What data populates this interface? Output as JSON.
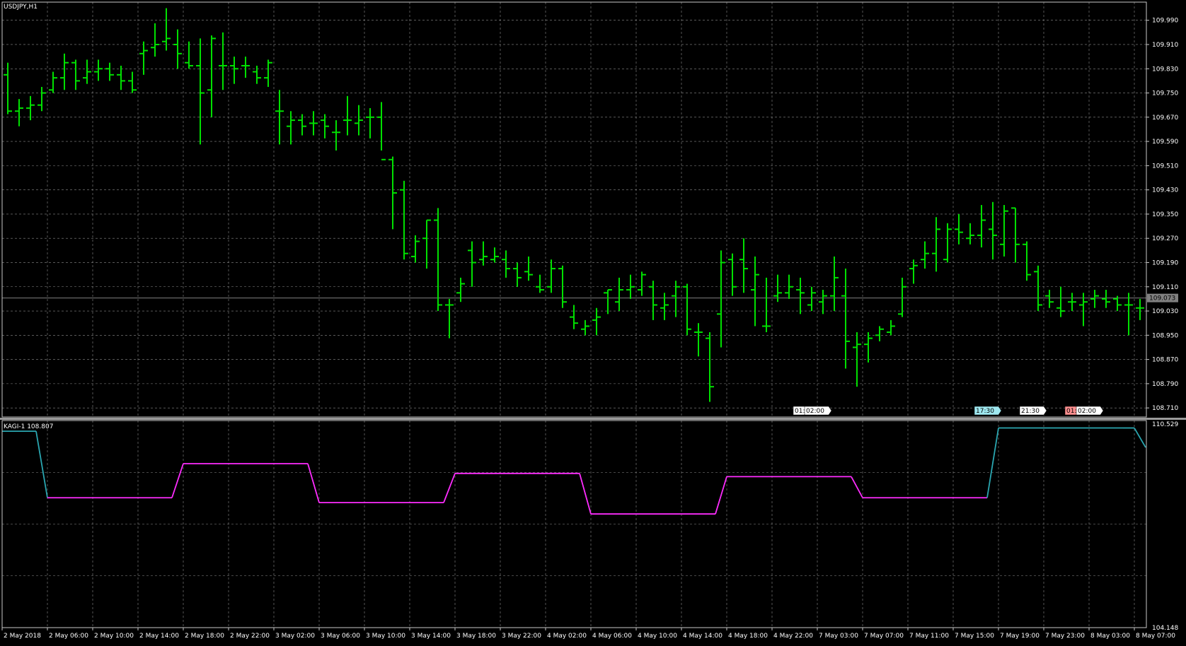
{
  "window": {
    "symbol_label": "USDJPY,H1"
  },
  "colors": {
    "background": "#000000",
    "grid": "#8c8c8c",
    "frame": "#c8c8c8",
    "bars": "#00e000",
    "kagi_yang": "#2aa6b0",
    "kagi_yin": "#ff2cff",
    "bid_line": "#808080"
  },
  "indicator": {
    "label": "KAGI-1 108.807"
  },
  "price_scale": {
    "ticks": [
      "109.990",
      "109.910",
      "109.830",
      "109.750",
      "109.670",
      "109.590",
      "109.510",
      "109.430",
      "109.350",
      "109.270",
      "109.190",
      "109.110",
      "109.030",
      "108.950",
      "108.870",
      "108.790",
      "108.710"
    ],
    "current_price": "109.073"
  },
  "indicator_scale": {
    "top": "110.529",
    "bottom": "104.148"
  },
  "time_axis": {
    "labels": [
      "2 May 2018",
      "2 May 06:00",
      "2 May 10:00",
      "2 May 14:00",
      "2 May 18:00",
      "2 May 22:00",
      "3 May 02:00",
      "3 May 06:00",
      "3 May 10:00",
      "3 May 14:00",
      "3 May 18:00",
      "3 May 22:00",
      "4 May 02:00",
      "4 May 06:00",
      "4 May 10:00",
      "4 May 14:00",
      "4 May 18:00",
      "4 May 22:00",
      "7 May 03:00",
      "7 May 07:00",
      "7 May 11:00",
      "7 May 15:00",
      "7 May 19:00",
      "7 May 23:00",
      "8 May 03:00",
      "8 May 07:00"
    ]
  },
  "event_markers": [
    {
      "text": "01:",
      "bar": 70,
      "fill": "#ffffff"
    },
    {
      "text": "02:00",
      "bar": 71,
      "fill": "#ffffff"
    },
    {
      "text": "17:30",
      "bar": 86,
      "fill": "#9fe8f0"
    },
    {
      "text": "21:30",
      "bar": 90,
      "fill": "#ffffff"
    },
    {
      "text": "01:",
      "bar": 94,
      "fill": "#ff9090"
    },
    {
      "text": "02:00",
      "bar": 95,
      "fill": "#ffffff"
    }
  ],
  "chart_data": [
    {
      "type": "ohlc",
      "title": "USDJPY,H1",
      "ylim": [
        108.68,
        110.05
      ],
      "bars": [
        [
          109.81,
          109.85,
          109.68,
          109.69
        ],
        [
          109.69,
          109.73,
          109.64,
          109.7
        ],
        [
          109.7,
          109.74,
          109.66,
          109.71
        ],
        [
          109.71,
          109.77,
          109.69,
          109.75
        ],
        [
          109.76,
          109.82,
          109.75,
          109.8
        ],
        [
          109.8,
          109.88,
          109.76,
          109.85
        ],
        [
          109.85,
          109.86,
          109.76,
          109.79
        ],
        [
          109.8,
          109.86,
          109.78,
          109.82
        ],
        [
          109.82,
          109.86,
          109.79,
          109.83
        ],
        [
          109.83,
          109.85,
          109.79,
          109.81
        ],
        [
          109.81,
          109.84,
          109.76,
          109.79
        ],
        [
          109.79,
          109.82,
          109.75,
          109.76
        ],
        [
          109.88,
          109.92,
          109.81,
          109.89
        ],
        [
          109.9,
          109.98,
          109.87,
          109.91
        ],
        [
          109.92,
          110.03,
          109.89,
          109.93
        ],
        [
          109.91,
          109.96,
          109.83,
          109.88
        ],
        [
          109.85,
          109.92,
          109.83,
          109.84
        ],
        [
          109.84,
          109.93,
          109.58,
          109.75
        ],
        [
          109.76,
          109.94,
          109.67,
          109.93
        ],
        [
          109.84,
          109.95,
          109.76,
          109.84
        ],
        [
          109.84,
          109.87,
          109.78,
          109.83
        ],
        [
          109.84,
          109.87,
          109.8,
          109.84
        ],
        [
          109.82,
          109.84,
          109.78,
          109.8
        ],
        [
          109.8,
          109.86,
          109.77,
          109.85
        ],
        [
          109.69,
          109.76,
          109.58,
          109.69
        ],
        [
          109.64,
          109.69,
          109.58,
          109.66
        ],
        [
          109.66,
          109.68,
          109.61,
          109.64
        ],
        [
          109.65,
          109.69,
          109.61,
          109.65
        ],
        [
          109.66,
          109.68,
          109.6,
          109.64
        ],
        [
          109.62,
          109.66,
          109.56,
          109.62
        ],
        [
          109.66,
          109.74,
          109.61,
          109.66
        ],
        [
          109.65,
          109.71,
          109.61,
          109.66
        ],
        [
          109.67,
          109.7,
          109.6,
          109.67
        ],
        [
          109.67,
          109.72,
          109.56,
          109.53
        ],
        [
          109.53,
          109.54,
          109.3,
          109.42
        ],
        [
          109.43,
          109.46,
          109.2,
          109.22
        ],
        [
          109.21,
          109.28,
          109.19,
          109.26
        ],
        [
          109.27,
          109.33,
          109.17,
          109.33
        ],
        [
          109.33,
          109.37,
          109.03,
          109.05
        ],
        [
          109.05,
          109.07,
          108.94,
          109.05
        ],
        [
          109.09,
          109.14,
          109.06,
          109.12
        ],
        [
          109.23,
          109.26,
          109.11,
          109.19
        ],
        [
          109.2,
          109.26,
          109.18,
          109.21
        ],
        [
          109.2,
          109.24,
          109.19,
          109.21
        ],
        [
          109.2,
          109.23,
          109.14,
          109.17
        ],
        [
          109.17,
          109.19,
          109.11,
          109.14
        ],
        [
          109.16,
          109.21,
          109.13,
          109.15
        ],
        [
          109.11,
          109.15,
          109.09,
          109.1
        ],
        [
          109.11,
          109.2,
          109.09,
          109.17
        ],
        [
          109.17,
          109.18,
          109.04,
          109.06
        ],
        [
          109.01,
          109.05,
          108.97,
          108.99
        ],
        [
          108.97,
          109.0,
          108.95,
          108.98
        ],
        [
          109.0,
          109.04,
          108.95,
          109.01
        ],
        [
          109.09,
          109.1,
          109.02,
          109.1
        ],
        [
          109.06,
          109.14,
          109.03,
          109.1
        ],
        [
          109.1,
          109.15,
          109.07,
          109.11
        ],
        [
          109.1,
          109.16,
          109.08,
          109.15
        ],
        [
          109.11,
          109.13,
          109.0,
          109.05
        ],
        [
          109.04,
          109.09,
          109.0,
          109.05
        ],
        [
          109.08,
          109.13,
          109.01,
          109.11
        ],
        [
          109.11,
          109.12,
          108.95,
          108.97
        ],
        [
          108.96,
          108.99,
          108.88,
          108.96
        ],
        [
          108.94,
          108.96,
          108.73,
          108.78
        ],
        [
          109.02,
          109.23,
          108.91,
          109.19
        ],
        [
          109.2,
          109.22,
          109.08,
          109.11
        ],
        [
          109.2,
          109.27,
          109.09,
          109.17
        ],
        [
          109.1,
          109.21,
          108.98,
          109.15
        ],
        [
          108.98,
          109.14,
          108.96,
          108.98
        ],
        [
          109.08,
          109.15,
          109.06,
          109.09
        ],
        [
          109.09,
          109.15,
          109.07,
          109.11
        ],
        [
          109.1,
          109.14,
          109.02,
          109.09
        ],
        [
          109.05,
          109.11,
          109.03,
          109.09
        ],
        [
          109.06,
          109.1,
          109.02,
          109.08
        ],
        [
          109.08,
          109.21,
          109.03,
          109.14
        ],
        [
          109.08,
          109.17,
          108.84,
          108.93
        ],
        [
          108.91,
          108.96,
          108.78,
          108.92
        ],
        [
          108.92,
          108.96,
          108.86,
          108.94
        ],
        [
          108.95,
          108.98,
          108.93,
          108.97
        ],
        [
          108.96,
          109.0,
          108.95,
          108.98
        ],
        [
          109.02,
          109.14,
          109.01,
          109.11
        ],
        [
          109.17,
          109.2,
          109.12,
          109.18
        ],
        [
          109.2,
          109.26,
          109.17,
          109.22
        ],
        [
          109.22,
          109.34,
          109.16,
          109.3
        ],
        [
          109.2,
          109.32,
          109.19,
          109.3
        ],
        [
          109.3,
          109.35,
          109.25,
          109.29
        ],
        [
          109.27,
          109.32,
          109.25,
          109.28
        ],
        [
          109.28,
          109.38,
          109.24,
          109.33
        ],
        [
          109.3,
          109.39,
          109.2,
          109.28
        ],
        [
          109.25,
          109.38,
          109.21,
          109.36
        ],
        [
          109.37,
          109.37,
          109.19,
          109.25
        ],
        [
          109.25,
          109.26,
          109.13,
          109.15
        ],
        [
          109.16,
          109.18,
          109.03,
          109.05
        ],
        [
          109.08,
          109.1,
          109.04,
          109.06
        ],
        [
          109.04,
          109.11,
          109.01,
          109.03
        ],
        [
          109.06,
          109.09,
          109.03,
          109.06
        ],
        [
          109.05,
          109.09,
          108.98,
          109.06
        ],
        [
          109.07,
          109.1,
          109.04,
          109.08
        ],
        [
          109.07,
          109.1,
          109.04,
          109.06
        ],
        [
          109.07,
          109.08,
          109.03,
          109.05
        ],
        [
          109.05,
          109.09,
          108.95,
          109.05
        ],
        [
          109.04,
          109.07,
          109.0,
          109.04
        ],
        [
          109.09,
          109.12,
          109.02,
          109.09
        ],
        [
          109.13,
          109.15,
          109.08,
          109.09
        ],
        [
          109.05,
          109.14,
          108.92,
          108.94
        ],
        [
          108.95,
          109.0,
          108.86,
          108.89
        ],
        [
          108.9,
          109.04,
          108.86,
          108.92
        ],
        [
          108.93,
          109.01,
          108.85,
          108.94
        ],
        [
          108.94,
          109.02,
          108.9,
          108.95
        ],
        [
          109.03,
          109.05,
          109.01,
          109.03
        ],
        [
          109.03,
          109.08,
          109.0,
          109.05
        ],
        [
          109.05,
          109.12,
          109.02,
          109.06
        ]
      ]
    },
    {
      "type": "line",
      "title": "KAGI-1 108.807",
      "ylim": [
        104.148,
        110.529
      ],
      "x_bar_index": [
        0,
        3,
        4,
        15,
        16,
        27,
        28,
        39,
        40,
        51,
        52,
        63,
        64,
        75,
        76,
        87,
        88,
        99,
        100,
        101
      ],
      "y": [
        110.2,
        110.2,
        108.15,
        108.15,
        109.2,
        109.2,
        108.0,
        108.0,
        108.9,
        108.9,
        107.65,
        107.65,
        108.8,
        108.8,
        108.15,
        108.15,
        110.3,
        110.3,
        110.3,
        109.7
      ],
      "segment_style": [
        "yang",
        "yang",
        "yin",
        "yin",
        "yin",
        "yin",
        "yin",
        "yin",
        "yin",
        "yin",
        "yin",
        "yin",
        "yin",
        "yin",
        "yin",
        "yang",
        "yang",
        "yang",
        "yang"
      ]
    }
  ]
}
